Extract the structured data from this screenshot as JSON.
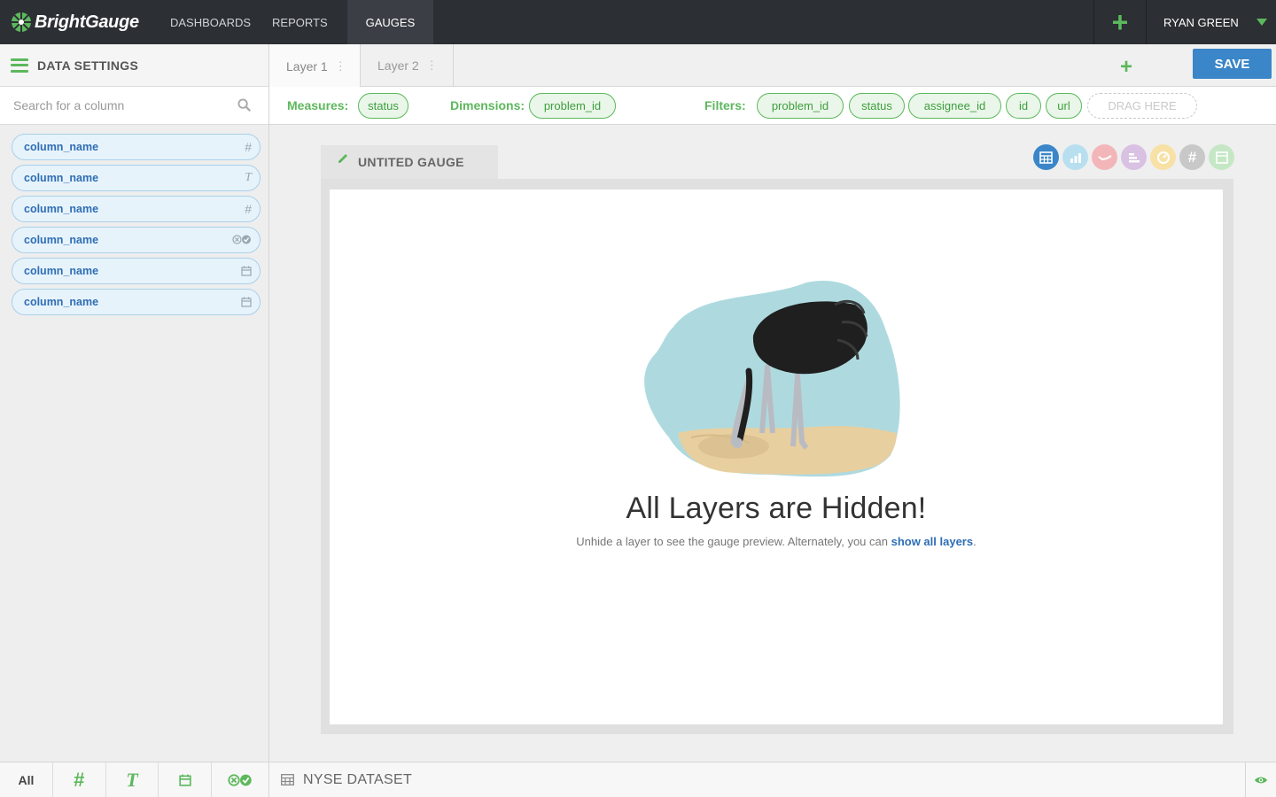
{
  "topnav": {
    "brand": "BrightGauge",
    "links": [
      "DASHBOARDS",
      "REPORTS",
      "GAUGES"
    ],
    "active": "GAUGES",
    "add_icon": "plus-icon",
    "user_name": "RYAN GREEN"
  },
  "sidebar": {
    "title": "DATA SETTINGS",
    "search_placeholder": "Search for a column",
    "columns": [
      {
        "name": "column_name",
        "type_icon": "#"
      },
      {
        "name": "column_name",
        "type_icon": "T"
      },
      {
        "name": "column_name",
        "type_icon": "#"
      },
      {
        "name": "column_name",
        "type_icon": "boolean"
      },
      {
        "name": "column_name",
        "type_icon": "calendar"
      },
      {
        "name": "column_name",
        "type_icon": "calendar"
      }
    ],
    "filter_tabs": {
      "all": "All",
      "number": "#",
      "text": "T"
    }
  },
  "layers": {
    "tabs": [
      "Layer 1",
      "Layer 2"
    ],
    "add_icon": "plus-icon",
    "save_label": "SAVE"
  },
  "builder": {
    "measures_label": "Measures:",
    "measures": [
      "status"
    ],
    "dimensions_label": "Dimensions:",
    "dimensions": [
      "problem_id"
    ],
    "filters_label": "Filters:",
    "filters": [
      "problem_id",
      "status",
      "assignee_id",
      "id",
      "url"
    ],
    "drag_here": "DRAG HERE"
  },
  "gauge": {
    "title": "UNTITED GAUGE",
    "viz_types": [
      "table",
      "bar",
      "line",
      "horizontal-bar",
      "dial",
      "number",
      "text"
    ],
    "empty_title": "All Layers are Hidden!",
    "empty_text": "Unhide a layer to see the gauge preview. Alternately, you can ",
    "empty_link": "show all layers",
    "empty_end": "."
  },
  "dataset": {
    "label": "NYSE DATASET"
  },
  "colors": {
    "brand_green": "#5cb85c",
    "save_blue": "#3a86c8",
    "nav_dark": "#2c2f33"
  }
}
